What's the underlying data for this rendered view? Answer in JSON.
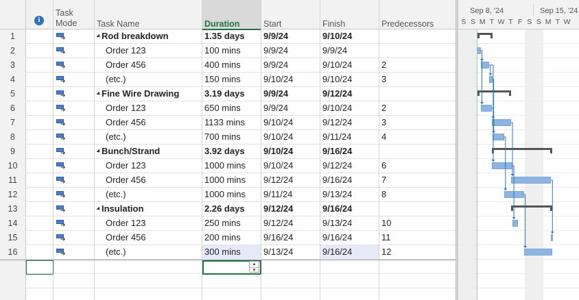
{
  "columns": {
    "info": "i",
    "mode_line1": "Task",
    "mode_line2": "Mode",
    "name": "Task Name",
    "duration": "Duration",
    "start": "Start",
    "finish": "Finish",
    "predecessors": "Predecessors"
  },
  "tasks": [
    {
      "id": "1",
      "name": "Rod breakdown",
      "duration": "1.35 days",
      "start": "9/9/24",
      "finish": "9/10/24",
      "pred": "",
      "summary": true
    },
    {
      "id": "2",
      "name": "Order 123",
      "duration": "100 mins",
      "start": "9/9/24",
      "finish": "9/9/24",
      "pred": "",
      "summary": false
    },
    {
      "id": "3",
      "name": "Order 456",
      "duration": "400 mins",
      "start": "9/9/24",
      "finish": "9/10/24",
      "pred": "2",
      "summary": false
    },
    {
      "id": "4",
      "name": "(etc.)",
      "duration": "150 mins",
      "start": "9/10/24",
      "finish": "9/10/24",
      "pred": "3",
      "summary": false
    },
    {
      "id": "5",
      "name": "Fine Wire Drawing",
      "duration": "3.19 days",
      "start": "9/9/24",
      "finish": "9/12/24",
      "pred": "",
      "summary": true
    },
    {
      "id": "6",
      "name": "Order 123",
      "duration": "650 mins",
      "start": "9/9/24",
      "finish": "9/10/24",
      "pred": "2",
      "summary": false
    },
    {
      "id": "7",
      "name": "Order 456",
      "duration": "1133 mins",
      "start": "9/10/24",
      "finish": "9/12/24",
      "pred": "3",
      "summary": false
    },
    {
      "id": "8",
      "name": "(etc.)",
      "duration": "700 mins",
      "start": "9/10/24",
      "finish": "9/11/24",
      "pred": "4",
      "summary": false
    },
    {
      "id": "9",
      "name": "Bunch/Strand",
      "duration": "3.92 days",
      "start": "9/10/24",
      "finish": "9/16/24",
      "pred": "",
      "summary": true
    },
    {
      "id": "10",
      "name": "Order 123",
      "duration": "1000 mins",
      "start": "9/10/24",
      "finish": "9/12/24",
      "pred": "6",
      "summary": false
    },
    {
      "id": "11",
      "name": "Order 456",
      "duration": "1000 mins",
      "start": "9/12/24",
      "finish": "9/16/24",
      "pred": "7",
      "summary": false
    },
    {
      "id": "12",
      "name": "(etc.)",
      "duration": "1000 mins",
      "start": "9/11/24",
      "finish": "9/13/24",
      "pred": "8",
      "summary": false
    },
    {
      "id": "13",
      "name": "Insulation",
      "duration": "2.26 days",
      "start": "9/12/24",
      "finish": "9/16/24",
      "pred": "",
      "summary": true
    },
    {
      "id": "14",
      "name": "Order 123",
      "duration": "250 mins",
      "start": "9/12/24",
      "finish": "9/13/24",
      "pred": "10",
      "summary": false
    },
    {
      "id": "15",
      "name": "Order 456",
      "duration": "200 mins",
      "start": "9/16/24",
      "finish": "9/16/24",
      "pred": "11",
      "summary": false
    },
    {
      "id": "16",
      "name": "(etc.)",
      "duration": "300 mins",
      "start": "9/13/24",
      "finish": "9/16/24",
      "pred": "12",
      "summary": false
    }
  ],
  "timescale": {
    "weeks": [
      "Sep 8, '24",
      "Sep 15, '24"
    ],
    "days": [
      "S",
      "S",
      "M",
      "T",
      "W",
      "T",
      "F",
      "S",
      "S",
      "M",
      "T",
      "W"
    ]
  },
  "colors": {
    "accent": "#217346",
    "task_bar": "#8db5e2",
    "summary_bar": "#555555",
    "selected_highlight": "#e6eaf8"
  },
  "icons": {
    "info_header": "info-icon",
    "task_mode": "auto-scheduled-task-icon"
  }
}
